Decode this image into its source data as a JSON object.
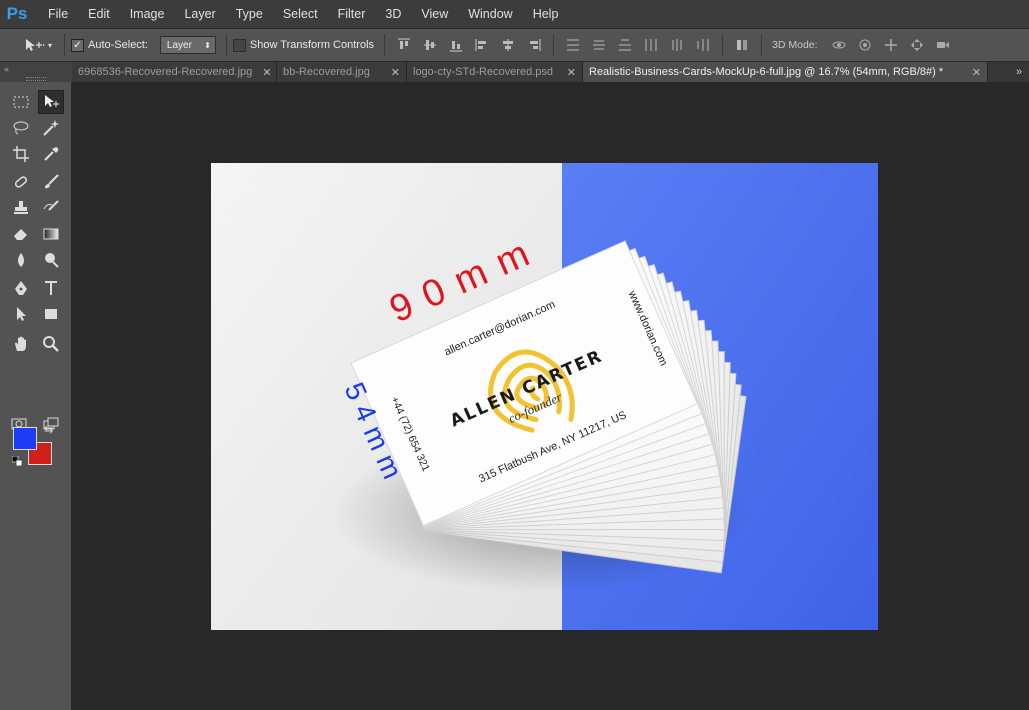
{
  "app": {
    "logo": "Ps"
  },
  "menu": [
    "File",
    "Edit",
    "Image",
    "Layer",
    "Type",
    "Select",
    "Filter",
    "3D",
    "View",
    "Window",
    "Help"
  ],
  "options": {
    "auto_select_label": "Auto-Select:",
    "auto_select_checked": true,
    "layer_select_value": "Layer",
    "show_transform_label": "Show Transform Controls",
    "show_transform_checked": false,
    "mode3d_label": "3D Mode:"
  },
  "tabs": [
    {
      "label": "6968536-Recovered-Recovered.jpg",
      "active": false
    },
    {
      "label": "bb-Recovered.jpg",
      "active": false
    },
    {
      "label": "logo-cty-STd-Recovered.psd",
      "active": false
    },
    {
      "label": "Realistic-Business-Cards-MockUp-6-full.jpg @ 16.7% (54mm, RGB/8#) *",
      "active": true
    }
  ],
  "colors": {
    "foreground": "#1c3cf5",
    "background": "#d0201a",
    "canvas_blue": "#4a6ff0",
    "logo_yellow": "#f2c230"
  },
  "card": {
    "email": "allen.carter@dorian.com",
    "name": "ALLEN CARTER",
    "title": "co-founder",
    "address": "315 Flatbush Ave, NY 11217, US",
    "website": "www.dorian.com",
    "phone": "+44 (72) 654 321"
  },
  "annotations": {
    "width_label": "90mm",
    "height_label": "54mm"
  }
}
